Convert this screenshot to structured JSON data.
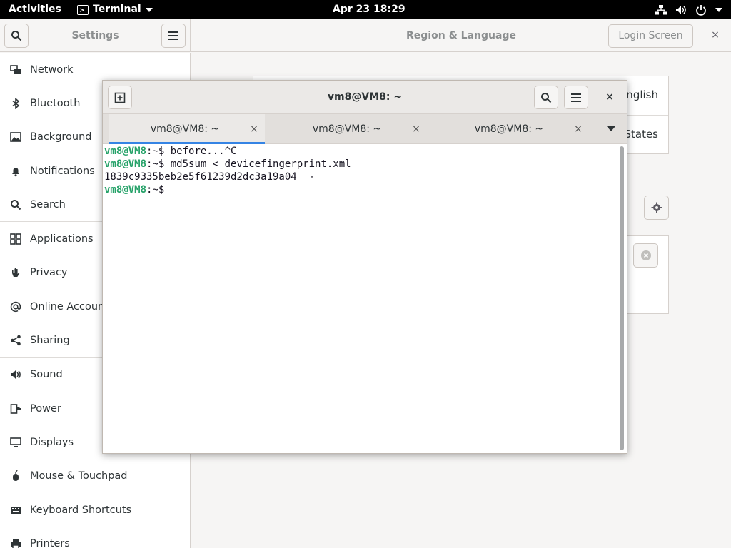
{
  "topbar": {
    "activities": "Activities",
    "app_name": "Terminal",
    "clock": "Apr 23  18:29"
  },
  "settings": {
    "title": "Settings",
    "page_title": "Region & Language",
    "login_screen_label": "Login Screen",
    "close_label": "×",
    "sidebar_items": [
      {
        "label": "Network",
        "icon": "network-icon"
      },
      {
        "label": "Bluetooth",
        "icon": "bluetooth-icon"
      },
      {
        "label": "Background",
        "icon": "background-icon"
      },
      {
        "label": "Notifications",
        "icon": "bell-icon"
      },
      {
        "label": "Search",
        "icon": "search-icon"
      },
      {
        "label": "Applications",
        "icon": "applications-grid-icon"
      },
      {
        "label": "Privacy",
        "icon": "hand-icon"
      },
      {
        "label": "Online Accounts",
        "icon": "at-sign-icon"
      },
      {
        "label": "Sharing",
        "icon": "share-icon"
      },
      {
        "label": "Sound",
        "icon": "speaker-icon"
      },
      {
        "label": "Power",
        "icon": "power-plug-icon"
      },
      {
        "label": "Displays",
        "icon": "display-icon"
      },
      {
        "label": "Mouse & Touchpad",
        "icon": "mouse-icon"
      },
      {
        "label": "Keyboard Shortcuts",
        "icon": "keyboard-icon"
      },
      {
        "label": "Printers",
        "icon": "printer-icon"
      }
    ],
    "language_value_partial": "English",
    "formats_value_partial": "States"
  },
  "terminal": {
    "title": "vm8@VM8: ~",
    "tabs": [
      {
        "label": "vm8@VM8: ~",
        "active": true
      },
      {
        "label": "vm8@VM8: ~",
        "active": false
      },
      {
        "label": "vm8@VM8: ~",
        "active": false
      }
    ],
    "tab_close_label": "×",
    "close_label": "×",
    "lines": [
      {
        "user": "vm8@VM8",
        "path": ":~$ ",
        "text": "before...^C"
      },
      {
        "user": "vm8@VM8",
        "path": ":~$ ",
        "text": "md5sum < devicefingerprint.xml"
      },
      {
        "user": "",
        "path": "",
        "text": "1839c9335beb2e5f61239d2dc3a19a04  -"
      },
      {
        "user": "vm8@VM8",
        "path": ":~$",
        "text": ""
      }
    ],
    "prompt_color": "#26a269"
  }
}
